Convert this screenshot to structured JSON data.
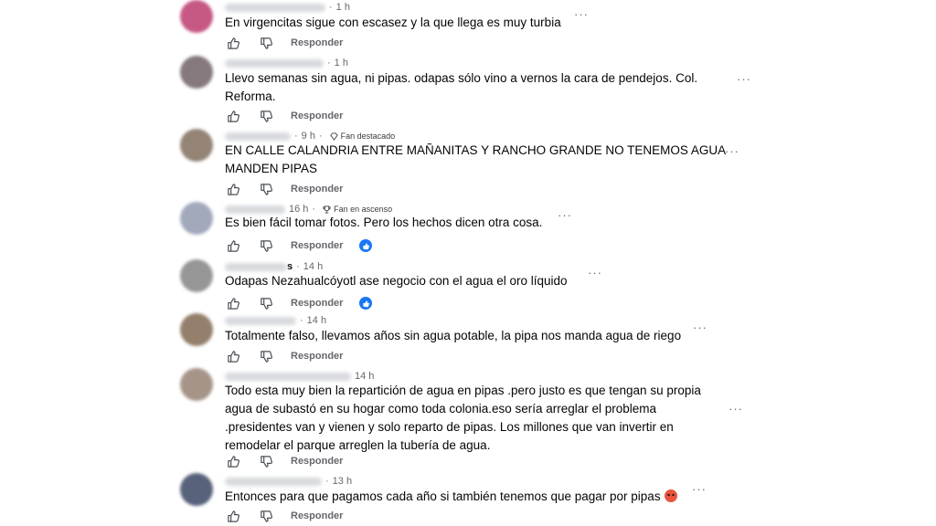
{
  "reply_label": "Responder",
  "more_label": "···",
  "comments": [
    {
      "time": "1 h",
      "badge": "",
      "text_lines": [
        "En virgencitas sigue con escasez y la que llega es muy turbia"
      ],
      "reaction": false,
      "avatar_color": "#c24a7a"
    },
    {
      "time": "1 h",
      "badge": "",
      "text_lines": [
        "Llevo semanas sin agua, ni pipas. odapas sólo vino a vernos la cara de pendejos. Col.",
        "Reforma."
      ],
      "reaction": false,
      "avatar_color": "#7b6e74"
    },
    {
      "time": "9 h",
      "badge": "Fan destacado",
      "badge_icon": "diamond-icon",
      "text_lines": [
        "EN CALLE CALANDRIA ENTRE MAÑANITAS Y RANCHO GRANDE NO TENEMOS AGUA",
        "MANDEN PIPAS"
      ],
      "reaction": false,
      "avatar_color": "#8a7a6a"
    },
    {
      "time": "16 h",
      "badge": "Fan en ascenso",
      "badge_icon": "trophy-icon",
      "text_lines": [
        "Es bien fácil tomar fotos. Pero los hechos dicen otra cosa."
      ],
      "reaction": true,
      "avatar_color": "#9aa2b5"
    },
    {
      "time": "14 h",
      "name_suffix": "s",
      "badge": "",
      "text_lines": [
        "Odapas Nezahualcóyotl ase negocio con el agua el oro líquido"
      ],
      "reaction": true,
      "avatar_color": "#8e8e8e"
    },
    {
      "time": "14 h",
      "badge": "",
      "text_lines": [
        "Totalmente falso, llevamos años sin agua potable, la pipa nos manda agua de riego"
      ],
      "reaction": false,
      "avatar_color": "#8c7560"
    },
    {
      "time": "14 h",
      "badge": "",
      "text_lines": [
        "Todo esta muy bien la repartición de agua en pipas .pero justo es que tengan su propia",
        "agua de subastó en su hogar como toda colonia.eso sería arreglar el problema",
        ".presidentes van y vienen y solo reparto de pipas. Los millones que van invertir en",
        "remodelar el parque arreglen la tubería de agua."
      ],
      "reaction": false,
      "avatar_color": "#a08c80"
    },
    {
      "time": "13 h",
      "badge": "",
      "text_lines": [
        "Entonces para que pagamos cada año si también tenemos que pagar por pipas"
      ],
      "emoji": "angry-face-emoji",
      "reaction": false,
      "avatar_color": "#4a5570"
    }
  ]
}
